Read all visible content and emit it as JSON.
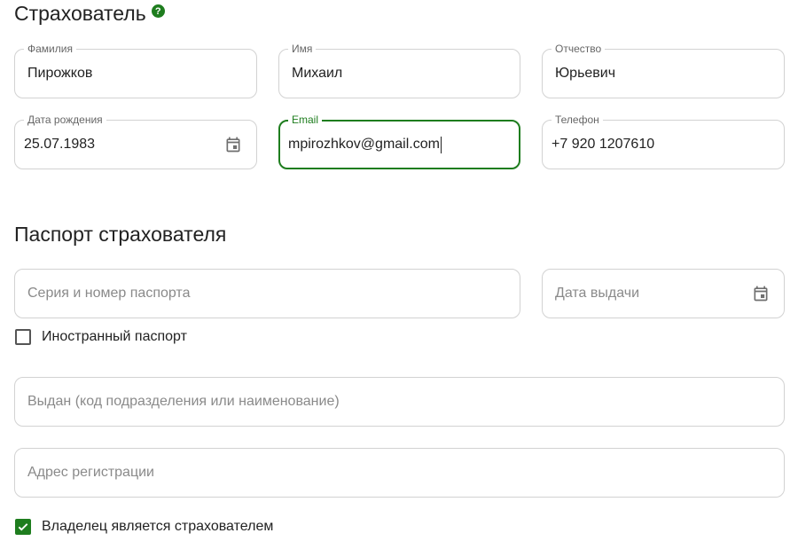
{
  "insurer": {
    "title": "Страхователь",
    "help_icon": "?",
    "fields": {
      "last_name": {
        "label": "Фамилия",
        "value": "Пирожков"
      },
      "first_name": {
        "label": "Имя",
        "value": "Михаил"
      },
      "patronymic": {
        "label": "Отчество",
        "value": "Юрьевич"
      },
      "birth_date": {
        "label": "Дата рождения",
        "value": "25.07.1983",
        "icon": "calendar-icon"
      },
      "email": {
        "label": "Email",
        "value": "mpirozhkov@gmail.com"
      },
      "phone": {
        "label": "Телефон",
        "value": "+7 920 1207610"
      }
    }
  },
  "passport": {
    "title": "Паспорт страхователя",
    "series_number": {
      "placeholder": "Серия и номер паспорта"
    },
    "issue_date": {
      "placeholder": "Дата выдачи",
      "icon": "calendar-icon"
    },
    "foreign_passport": {
      "label": "Иностранный паспорт",
      "checked": false
    },
    "issued_by": {
      "placeholder": "Выдан (код подразделения или наименование)"
    },
    "registration_address": {
      "placeholder": "Адрес регистрации"
    },
    "owner_is_insurer": {
      "label": "Владелец является страхователем",
      "checked": true
    }
  },
  "colors": {
    "accent": "#1e7d1e",
    "border": "#d2d2d2",
    "placeholder": "#8a8a8a"
  }
}
